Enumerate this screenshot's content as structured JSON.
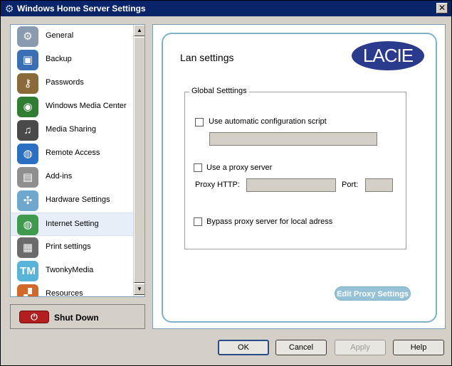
{
  "window": {
    "title": "Windows Home Server Settings",
    "close_glyph": "✕"
  },
  "sidebar": {
    "items": [
      {
        "label": "General",
        "icon": "gear-icon",
        "color": "#8a9bb0",
        "glyph": "⚙",
        "selected": false
      },
      {
        "label": "Backup",
        "icon": "backup-icon",
        "color": "#3b6fb5",
        "glyph": "▣",
        "selected": false
      },
      {
        "label": "Passwords",
        "icon": "passwords-icon",
        "color": "#8b6a3a",
        "glyph": "⚷",
        "selected": false
      },
      {
        "label": "Windows Media Center",
        "icon": "media-center-icon",
        "color": "#2f7d32",
        "glyph": "◉",
        "selected": false
      },
      {
        "label": "Media Sharing",
        "icon": "media-sharing-icon",
        "color": "#4a4a4a",
        "glyph": "♫",
        "selected": false
      },
      {
        "label": "Remote Access",
        "icon": "globe-icon",
        "color": "#2a6fc4",
        "glyph": "◍",
        "selected": false
      },
      {
        "label": "Add-ins",
        "icon": "add-ins-icon",
        "color": "#8f8f8f",
        "glyph": "▤",
        "selected": false
      },
      {
        "label": "Hardware Settings",
        "icon": "fan-icon",
        "color": "#6fa8cf",
        "glyph": "✣",
        "selected": false
      },
      {
        "label": "Internet Setting",
        "icon": "internet-icon",
        "color": "#3f9a4d",
        "glyph": "◍",
        "selected": true
      },
      {
        "label": "Print settings",
        "icon": "printer-icon",
        "color": "#6b6b6b",
        "glyph": "▦",
        "selected": false
      },
      {
        "label": "TwonkyMedia",
        "icon": "twonky-icon",
        "color": "#58b4d8",
        "glyph": "TM",
        "selected": false
      },
      {
        "label": "Resources",
        "icon": "resources-icon",
        "color": "#d2692a",
        "glyph": "▞",
        "selected": false
      }
    ],
    "scroll_up_glyph": "▲",
    "scroll_down_glyph": "▼"
  },
  "shutdown": {
    "label": "Shut Down",
    "icon_glyph": "⏻"
  },
  "content": {
    "title": "Lan settings",
    "logo_text": "LACIE",
    "group_title": "Global Setttings",
    "auto_config_label": "Use automatic configuration script",
    "auto_config_value": "",
    "proxy_label": "Use a proxy server",
    "proxy_http_label": "Proxy HTTP:",
    "proxy_http_value": "",
    "port_label": "Port:",
    "port_value": "",
    "bypass_label": "Bypass proxy server for local adress",
    "edit_proxy_label": "Edit Proxy Settings"
  },
  "footer": {
    "ok": "OK",
    "cancel": "Cancel",
    "apply": "Apply",
    "help": "Help"
  }
}
